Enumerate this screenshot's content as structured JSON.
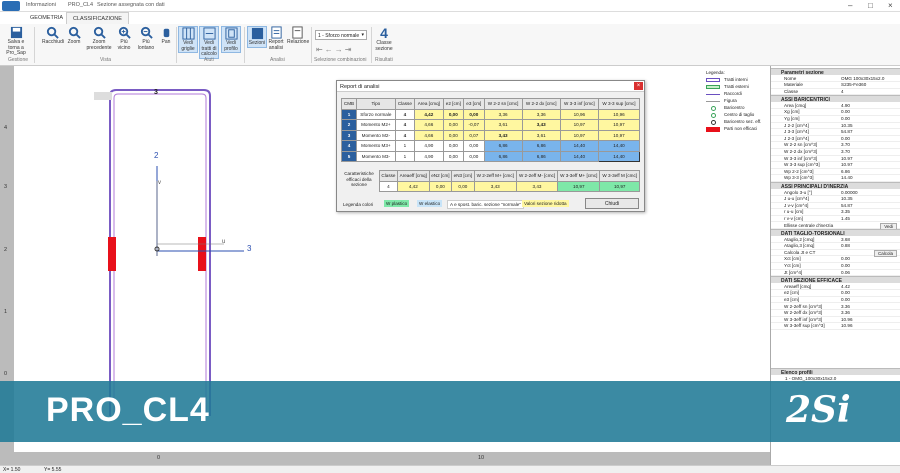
{
  "titlebar": {
    "app": "Informazioni",
    "file": "PRO_CL4",
    "subtitle": "Sezione assegnata con dati"
  },
  "tabs": [
    "GEOMETRIA",
    "CLASSIFICAZIONE"
  ],
  "ribbon": {
    "buttons": [
      "Salva e torna a Pro_Sap",
      "Racchiudi",
      "Zoom",
      "Zoom precedente",
      "Più vicino",
      "Più lontano",
      "Pan",
      "Vedi griglie",
      "Vedi tratti di calcolo",
      "Vedi profilo",
      "Sezioni",
      "Report analisi",
      "Relazione",
      "1 - Sforzo normale",
      "Classe sezione"
    ],
    "groups": [
      "Gestione",
      "Vista",
      "Aiuti",
      "Analisi",
      "Selezione combinazioni",
      "Risultati"
    ],
    "classe_value": "4"
  },
  "canvas": {
    "axes": {
      "u": "u",
      "v": "v",
      "axis2": "2",
      "axis3": "3",
      "dim_top": "3"
    },
    "ruler_left": [
      "4",
      "3",
      "2",
      "1",
      "0"
    ],
    "ruler_bottom": [
      "0",
      "10"
    ]
  },
  "legend": {
    "title": "Legenda:",
    "items": [
      "Tratti interni",
      "Tratti esterni",
      "Raccordi",
      "Figura",
      "Baricentro",
      "Centro di taglio",
      "Baricentro sez. eff.",
      "Parti non efficaci"
    ]
  },
  "dialog": {
    "title": "Report di analisi",
    "close": "×",
    "headers": [
      "CMB",
      "Tipo",
      "Classe",
      "Area [cmq]",
      "e2 [cm]",
      "e3 [cm]",
      "W 2-2 sn [cmc]",
      "W 2-2 dx [cmc]",
      "W 3-3 inf [cmc]",
      "W 3-3 sup [cmc]"
    ],
    "rows": [
      [
        "1",
        "Sforzo normale",
        "4",
        "4,42",
        "0,00",
        "0,00",
        "3,36",
        "3,36",
        "10,96",
        "10,96"
      ],
      [
        "2",
        "Momento M2+",
        "4",
        "4,66",
        "0,00",
        "-0,07",
        "3,61",
        "3,43",
        "10,97",
        "10,97"
      ],
      [
        "3",
        "Momento M2-",
        "4",
        "4,66",
        "0,00",
        "0,07",
        "3,43",
        "3,61",
        "10,97",
        "10,97"
      ],
      [
        "4",
        "Momento M3+",
        "1",
        "4,90",
        "0,00",
        "0,00",
        "6,86",
        "6,86",
        "14,40",
        "14,40"
      ],
      [
        "5",
        "Momento M3-",
        "1",
        "4,90",
        "0,00",
        "0,00",
        "6,86",
        "6,86",
        "14,40",
        "14,40"
      ]
    ],
    "eff_label": "Caratteristiche efficaci della sezione",
    "eff_headers": [
      "Classe",
      "Areaeff [cmq]",
      "eN2 [cm]",
      "eN3 [cm]",
      "W 2-2eff M+ [cmc]",
      "W 2-2eff M- [cmc]",
      "W 3-3eff M+ [cmc]",
      "W 3-3eff M [cmc]"
    ],
    "eff_row": [
      "4",
      "4,42",
      "0,00",
      "0,00",
      "3,43",
      "3,43",
      "10,97",
      "10,97"
    ],
    "legend_label": "Legenda colori",
    "legend_items": [
      "W plastico",
      "W elastico",
      "A e spost. baric. sezione \"normale\"",
      "Valori sezione ridotta"
    ],
    "close_button": "Chiudi"
  },
  "panel": {
    "sections": [
      {
        "title": "Parametri sezione",
        "rows": [
          [
            "Nome",
            "OMG 100x30x15x2.0"
          ],
          [
            "Materiale",
            "S235-Fe360"
          ],
          [
            "Classe",
            "4"
          ]
        ]
      },
      {
        "title": "ASSI BARICENTRICI",
        "rows": [
          [
            "Area [cmq]",
            "4.90"
          ],
          [
            "Xg [cm]",
            "0.00"
          ],
          [
            "Yg [cm]",
            "0.00"
          ],
          [
            "J 2-2 [cm^4]",
            "10.35"
          ],
          [
            "J 3-3 [cm^4]",
            "54.87"
          ],
          [
            "J 2-3 [cm^4]",
            "0.00"
          ],
          [
            "W 2-2 sn [cm^3]",
            "3.70"
          ],
          [
            "W 2-2 dx [cm^3]",
            "3.70"
          ],
          [
            "W 3-3 inf [cm^3]",
            "10.97"
          ],
          [
            "W 3-3 sup [cm^3]",
            "10.97"
          ],
          [
            "Wp 2-2 [cm^3]",
            "6.86"
          ],
          [
            "Wp 3-3 [cm^3]",
            "14.40"
          ]
        ]
      },
      {
        "title": "ASSI PRINCIPALI D'INERZIA",
        "rows": [
          [
            "Angolo 3-u [°]",
            "0.00000"
          ],
          [
            "J u-u [cm^4]",
            "10.35"
          ],
          [
            "J v-v [cm^4]",
            "54.87"
          ],
          [
            "r u-u [cm]",
            "3.35"
          ],
          [
            "r v-v [cm]",
            "1.45"
          ],
          [
            "Ellisse centrale d'inerzia",
            "Vedi"
          ]
        ]
      },
      {
        "title": "DATI TAGLIO-TORSIONALI",
        "rows": [
          [
            "Ataglio,2 [cmq]",
            "3.68"
          ],
          [
            "Ataglio,3 [cmq]",
            "0.88"
          ],
          [
            "Calcola Jt e CT",
            "Calcola"
          ],
          [
            "Xct [cm]",
            "0.00"
          ],
          [
            "Yct [cm]",
            "0.00"
          ],
          [
            "Jt [cm^4]",
            "0.06"
          ]
        ]
      },
      {
        "title": "DATI SEZIONE EFFICACE",
        "rows": [
          [
            "Areaeff [cmq]",
            "4.42"
          ],
          [
            "e2 [cm]",
            "0.00"
          ],
          [
            "e3 [cm]",
            "0.00"
          ],
          [
            "W 2-2eff sn [cm^3]",
            "3.36"
          ],
          [
            "W 2-2eff dx [cm^3]",
            "3.36"
          ],
          [
            "W 3-3eff inf [cm^3]",
            "10.96"
          ],
          [
            "W 3-3eff sup [cm^3]",
            "10.96"
          ]
        ]
      }
    ],
    "profiles_title": "Elenco profili",
    "profile_item": "1 - OMG_100x30x15x2.0"
  },
  "status": {
    "x": "X= 1.50",
    "y": "Y= 5.55"
  },
  "banner": {
    "title": "PRO_CL4",
    "logo": "2Si"
  },
  "colors": {
    "accent": "#2b5f9e",
    "banner": "#207a96",
    "red": "#e8101a"
  }
}
